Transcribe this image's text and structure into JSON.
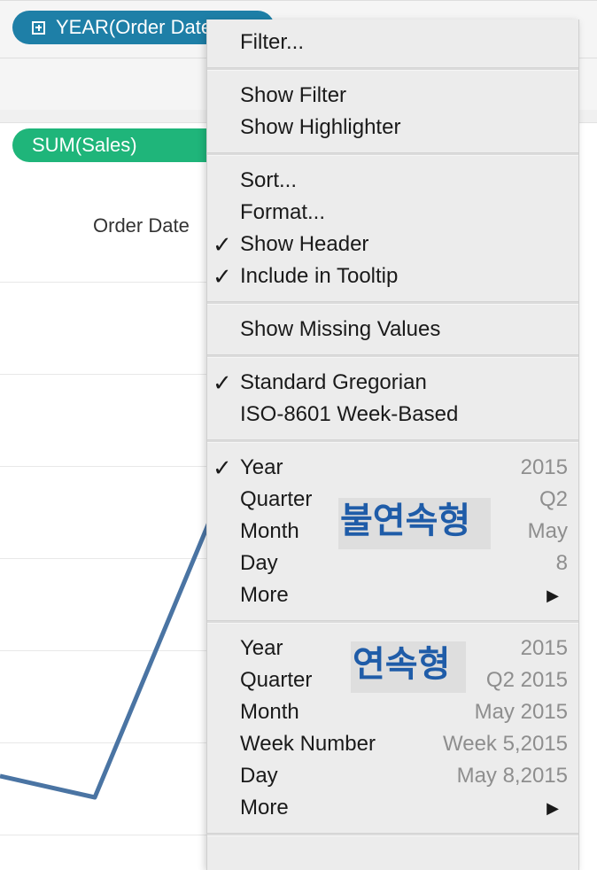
{
  "shelves": {
    "columns_pill": {
      "label": "YEAR(Order Date)",
      "color": "#1e7fa7"
    },
    "rows_pill": {
      "label": "SUM(Sales)",
      "color": "#1fb57a"
    }
  },
  "view": {
    "header_label": "Order Date",
    "line_color": "#4a74a3"
  },
  "context_menu": {
    "groups": [
      {
        "items": [
          {
            "label": "Filter...",
            "checked": false
          }
        ]
      },
      {
        "items": [
          {
            "label": "Show Filter",
            "checked": false
          },
          {
            "label": "Show Highlighter",
            "checked": false
          }
        ]
      },
      {
        "items": [
          {
            "label": "Sort...",
            "checked": false
          },
          {
            "label": "Format...",
            "checked": false
          },
          {
            "label": "Show Header",
            "checked": true
          },
          {
            "label": "Include in Tooltip",
            "checked": true
          }
        ]
      },
      {
        "items": [
          {
            "label": "Show Missing Values",
            "checked": false
          }
        ]
      },
      {
        "items": [
          {
            "label": "Standard Gregorian",
            "checked": true
          },
          {
            "label": "ISO-8601 Week-Based",
            "checked": false
          }
        ]
      },
      {
        "items": [
          {
            "label": "Year",
            "value": "2015",
            "checked": true
          },
          {
            "label": "Quarter",
            "value": "Q2",
            "checked": false
          },
          {
            "label": "Month",
            "value": "May",
            "checked": false
          },
          {
            "label": "Day",
            "value": "8",
            "checked": false
          },
          {
            "label": "More",
            "submenu": true,
            "checked": false
          }
        ]
      },
      {
        "items": [
          {
            "label": "Year",
            "value": "2015",
            "checked": false
          },
          {
            "label": "Quarter",
            "value": "Q2 2015",
            "checked": false
          },
          {
            "label": "Month",
            "value": "May 2015",
            "checked": false
          },
          {
            "label": "Week Number",
            "value": "Week 5,2015",
            "checked": false
          },
          {
            "label": "Day",
            "value": "May 8,2015",
            "checked": false
          },
          {
            "label": "More",
            "submenu": true,
            "checked": false
          }
        ]
      }
    ]
  },
  "annotations": {
    "discrete": "불연속형",
    "continuous": "연속형",
    "color": "#1f5ca8"
  },
  "glyphs": {
    "check": "✓",
    "submenu_arrow": "▶"
  }
}
